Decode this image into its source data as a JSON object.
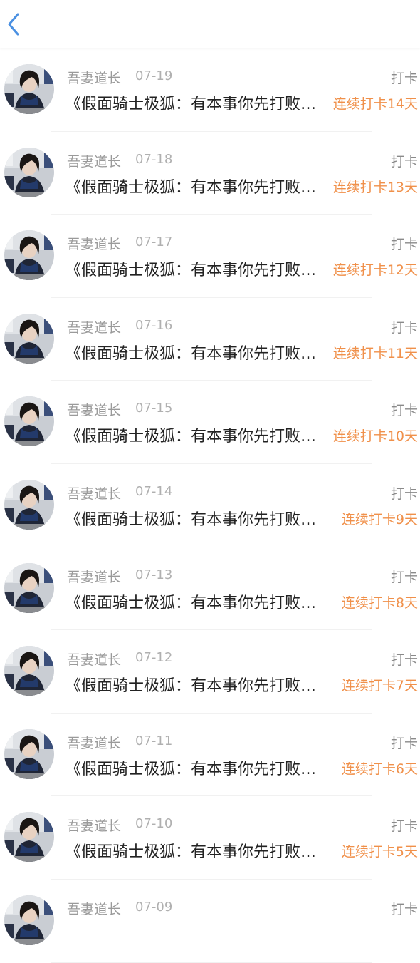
{
  "header": {
    "back_icon": "chevron-left-icon",
    "accent_color": "#4a90e2"
  },
  "colors": {
    "streak": "#f0904a",
    "name": "#9a9a9a",
    "title": "#222222"
  },
  "items": [
    {
      "name": "吾妻道长",
      "date": "07-19",
      "type": "打卡",
      "title": "《假面骑士极狐：有本事你先打败…",
      "streak": "连续打卡14天"
    },
    {
      "name": "吾妻道长",
      "date": "07-18",
      "type": "打卡",
      "title": "《假面骑士极狐：有本事你先打败…",
      "streak": "连续打卡13天"
    },
    {
      "name": "吾妻道长",
      "date": "07-17",
      "type": "打卡",
      "title": "《假面骑士极狐：有本事你先打败…",
      "streak": "连续打卡12天"
    },
    {
      "name": "吾妻道长",
      "date": "07-16",
      "type": "打卡",
      "title": "《假面骑士极狐：有本事你先打败…",
      "streak": "连续打卡11天"
    },
    {
      "name": "吾妻道长",
      "date": "07-15",
      "type": "打卡",
      "title": "《假面骑士极狐：有本事你先打败…",
      "streak": "连续打卡10天"
    },
    {
      "name": "吾妻道长",
      "date": "07-14",
      "type": "打卡",
      "title": "《假面骑士极狐：有本事你先打败…",
      "streak": "连续打卡9天"
    },
    {
      "name": "吾妻道长",
      "date": "07-13",
      "type": "打卡",
      "title": "《假面骑士极狐：有本事你先打败…",
      "streak": "连续打卡8天"
    },
    {
      "name": "吾妻道长",
      "date": "07-12",
      "type": "打卡",
      "title": "《假面骑士极狐：有本事你先打败…",
      "streak": "连续打卡7天"
    },
    {
      "name": "吾妻道长",
      "date": "07-11",
      "type": "打卡",
      "title": "《假面骑士极狐：有本事你先打败…",
      "streak": "连续打卡6天"
    },
    {
      "name": "吾妻道长",
      "date": "07-10",
      "type": "打卡",
      "title": "《假面骑士极狐：有本事你先打败…",
      "streak": "连续打卡5天"
    },
    {
      "name": "吾妻道长",
      "date": "07-09",
      "type": "打卡",
      "title": "",
      "streak": ""
    }
  ]
}
